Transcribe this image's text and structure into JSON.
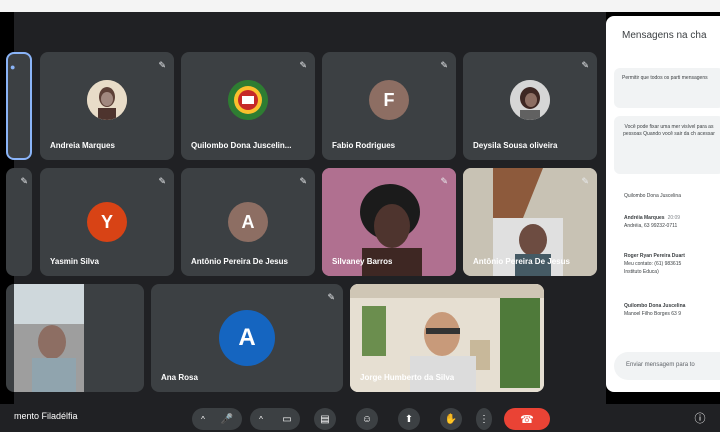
{
  "participants": {
    "andreia": {
      "name": "Andreia Marques"
    },
    "quilombo": {
      "name": "Quilombo Dona Juscelin..."
    },
    "fabio": {
      "name": "Fabio Rodrigues",
      "initial": "F",
      "color": "#8d6e63"
    },
    "deysila": {
      "name": "Deysila Sousa oliveira"
    },
    "yasmin": {
      "name": "Yasmin Silva",
      "initial": "Y",
      "color": "#d84315"
    },
    "antonio1": {
      "name": "Antônio Pereira De Jesus",
      "initial": "A",
      "color": "#8d6e63"
    },
    "silvaney": {
      "name": "Silvaney Barros"
    },
    "antonio2": {
      "name": "Antônio Pereira De Jesus"
    },
    "ana": {
      "name": "Ana Rosa",
      "initial": "A",
      "color": "#1565c0"
    },
    "jorge": {
      "name": "Jorge Humberto da Silva"
    }
  },
  "meeting": {
    "name": "mento Filadélfia"
  },
  "chat": {
    "title": "Mensagens na cha",
    "toggle_text": "Permitir que todos os parti mensagens",
    "pinned_text": "Você pode fixar uma mer visível para as pessoas Quando você sair da ch acessar",
    "messages": [
      {
        "sender": "",
        "time": "",
        "text": "Quilombo Dona Juscelina"
      },
      {
        "sender": "Andréia Marques",
        "time": "20:09",
        "text": "Andréia, 63 99232-0711"
      },
      {
        "sender": "Roger Ryan Pereira Duart",
        "time": "",
        "text": "Meu contato: (61) 983615"
      },
      {
        "sender": "",
        "time": "",
        "text": "Instituto Educa)"
      },
      {
        "sender": "Quilombo Dona Juscelina",
        "time": "",
        "text": "Manoel Filho Borges 63 9"
      }
    ],
    "input_placeholder": "Enviar mensagem para to"
  },
  "icons": {
    "mic": "🎤",
    "cam": "▭",
    "cc": "▤",
    "emoji": "☺",
    "present": "⬆",
    "hand": "✋",
    "more": "⋮",
    "end": "☎",
    "info": "ⓘ",
    "chevron": "^",
    "mic_off": "🔇"
  },
  "colors": {
    "background": "#202124",
    "tile": "#3c4043",
    "end_call": "#ea4335",
    "chat_bg": "#ffffff"
  }
}
